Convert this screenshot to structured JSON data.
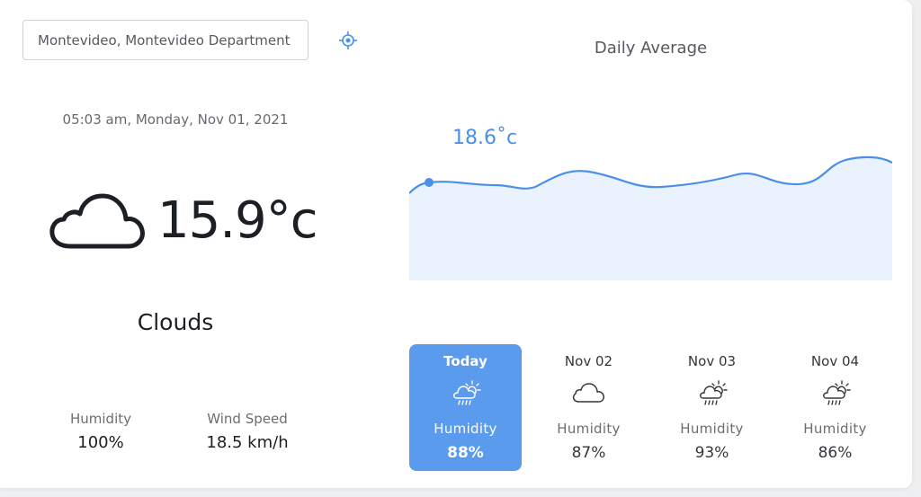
{
  "search": {
    "value": "Montevideo, Montevideo Department"
  },
  "current": {
    "datetime": "05:03 am, Monday, Nov 01, 2021",
    "temperature": "15.9°c",
    "condition": "Clouds",
    "icon": "cloud-icon",
    "humidity_label": "Humidity",
    "humidity_value": "100%",
    "wind_label": "Wind Speed",
    "wind_value": "18.5 km/h"
  },
  "daily": {
    "title": "Daily Average",
    "highlight_label": "18.6˚c",
    "colors": {
      "line": "#4a8fe8",
      "fill": "#eaf2fd",
      "accent": "#5b9bee"
    }
  },
  "forecast": [
    {
      "day": "Today",
      "icon": "rain-sun-icon",
      "humidity_label": "Humidity",
      "humidity": "88%",
      "active": true
    },
    {
      "day": "Nov 02",
      "icon": "cloud-icon",
      "humidity_label": "Humidity",
      "humidity": "87%",
      "active": false
    },
    {
      "day": "Nov 03",
      "icon": "rain-sun-icon",
      "humidity_label": "Humidity",
      "humidity": "93%",
      "active": false
    },
    {
      "day": "Nov 04",
      "icon": "rain-sun-icon",
      "humidity_label": "Humidity",
      "humidity": "86%",
      "active": false
    }
  ]
}
